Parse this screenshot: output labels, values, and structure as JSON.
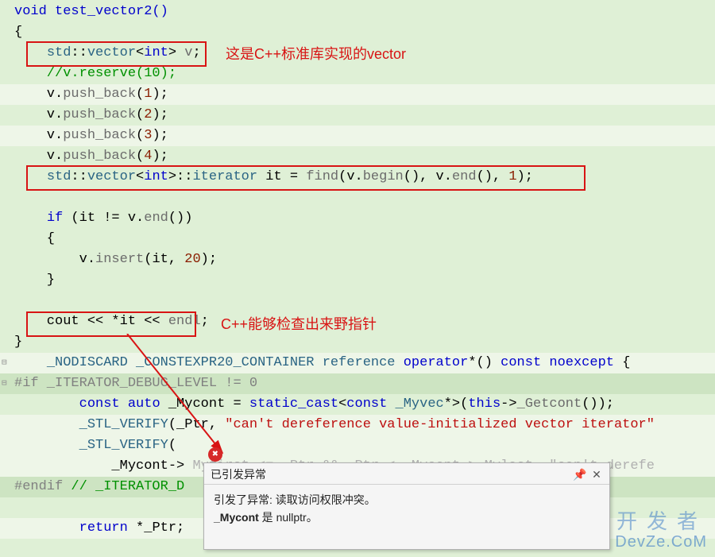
{
  "lines": {
    "l0": "void test_vector2()",
    "l1": "{",
    "l2p": "    ",
    "l2a": "std",
    "l2b": "::",
    "l2c": "vector",
    "l2d": "<",
    "l2e": "int",
    "l2f": "> ",
    "l2g": "v",
    "l2h": ";",
    "l3": "    //v.reserve(10);",
    "l4p": "    v.",
    "l4a": "push_back",
    "l4b": "(",
    "l4n": "1",
    "l4c": ");",
    "l5n": "2",
    "l6n": "3",
    "l7n": "4",
    "l8p": "    ",
    "l8a": "std",
    "l8b": "::",
    "l8c": "vector",
    "l8d": "<",
    "l8e": "int",
    "l8f": ">::",
    "l8g": "iterator",
    "l8h": " it = ",
    "l8i": "find",
    "l8j": "(v.",
    "l8k": "begin",
    "l8l": "(), v.",
    "l8m": "end",
    "l8n": "(), ",
    "l8o": "1",
    "l8q": ");",
    "l10a": "    ",
    "l10b": "if",
    "l10c": " (it != v.",
    "l10d": "end",
    "l10e": "())",
    "l11": "    {",
    "l12a": "        v.",
    "l12b": "insert",
    "l12c": "(it, ",
    "l12d": "20",
    "l12e": ");",
    "l13": "    }",
    "l15a": "    cout << *it << ",
    "l15b": "endl",
    "l15c": ";",
    "l16": "}",
    "l17a": "    ",
    "l17b": "_NODISCARD",
    "l17c": " ",
    "l17d": "_CONSTEXPR20_CONTAINER",
    "l17e": " ",
    "l17f": "reference",
    "l17g": " ",
    "l17h": "operator",
    "l17i": "*() ",
    "l17j": "const",
    "l17k": " ",
    "l17l": "noexcept",
    "l17m": " {",
    "l18a": "#if",
    "l18b": " _ITERATOR_DEBUG_LEVEL != 0",
    "l19a": "        ",
    "l19b": "const",
    "l19c": " ",
    "l19d": "auto",
    "l19e": " _Mycont = ",
    "l19f": "static_cast",
    "l19g": "<",
    "l19h": "const",
    "l19i": " ",
    "l19j": "_Myvec",
    "l19k": "*>(",
    "l19l": "this",
    "l19m": "->",
    "l19n": "_Getcont",
    "l19o": "());",
    "l20a": "        ",
    "l20b": "_STL_VERIFY",
    "l20c": "(_Ptr, ",
    "l20d": "\"can't dereference value-initialized vector iterator\"",
    "l21a": "        ",
    "l21b": "_STL_VERIFY",
    "l21c": "(",
    "l22a": "            _Mycont-> ",
    "l22b": "Myfirst <= _Ptr && _Ptr < _Mycont-> Mylast, \"can't derefe",
    "l23a": "#endif",
    "l23b": " // _ITERATOR_D",
    "l25a": "        ",
    "l25b": "return",
    "l25c": " *_Ptr;"
  },
  "annotations": {
    "a1": "这是C++标准库实现的vector",
    "a2": "C++能够检查出来野指针"
  },
  "popup": {
    "title": "已引发异常",
    "body1": "引发了异常: 读取访问权限冲突。",
    "body2a": "_Mycont",
    "body2b": " 是 nullptr。"
  },
  "watermark": {
    "line1": "开发者",
    "line2": "DevZe.CoM"
  },
  "colors": {
    "accent_red": "#d81414",
    "bg": "#dff0d6"
  }
}
